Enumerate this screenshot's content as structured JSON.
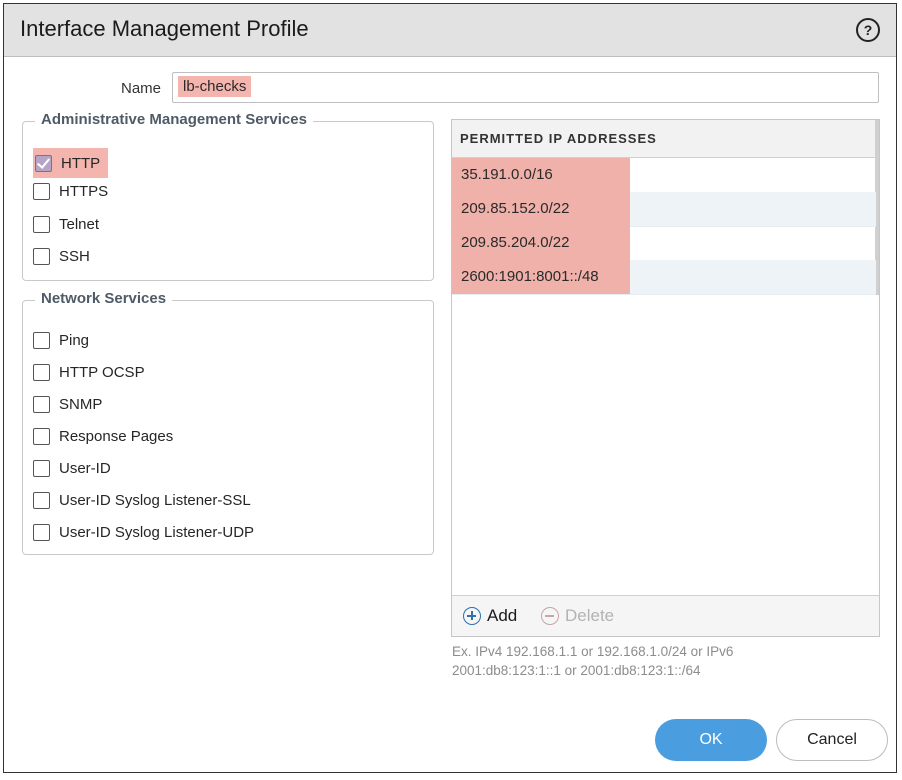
{
  "dialog": {
    "title": "Interface Management Profile",
    "help_icon": "question-circle-icon",
    "help_glyph": "?"
  },
  "name_field": {
    "label": "Name",
    "value": "lb-checks"
  },
  "admin_services": {
    "legend": "Administrative Management Services",
    "items": [
      {
        "label": "HTTP",
        "checked": true
      },
      {
        "label": "HTTPS",
        "checked": false
      },
      {
        "label": "Telnet",
        "checked": false
      },
      {
        "label": "SSH",
        "checked": false
      }
    ]
  },
  "network_services": {
    "legend": "Network Services",
    "items": [
      {
        "label": "Ping",
        "checked": false
      },
      {
        "label": "HTTP OCSP",
        "checked": false
      },
      {
        "label": "SNMP",
        "checked": false
      },
      {
        "label": "Response Pages",
        "checked": false
      },
      {
        "label": "User-ID",
        "checked": false
      },
      {
        "label": "User-ID Syslog Listener-SSL",
        "checked": false
      },
      {
        "label": "User-ID Syslog Listener-UDP",
        "checked": false
      }
    ]
  },
  "permitted_ips": {
    "header": "PERMITTED IP ADDRESSES",
    "rows": [
      "35.191.0.0/16",
      "209.85.152.0/22",
      "209.85.204.0/22",
      "2600:1901:8001::/48"
    ],
    "add_label": "Add",
    "delete_label": "Delete",
    "hint_line1": "Ex. IPv4 192.168.1.1 or 192.168.1.0/24 or IPv6",
    "hint_line2": "2001:db8:123:1::1 or 2001:db8:123:1::/64"
  },
  "buttons": {
    "ok": "OK",
    "cancel": "Cancel"
  },
  "colors": {
    "highlight": "#f3b5ae",
    "primary": "#4a9ee0",
    "checkbox_checked": "#b6a4c6"
  }
}
